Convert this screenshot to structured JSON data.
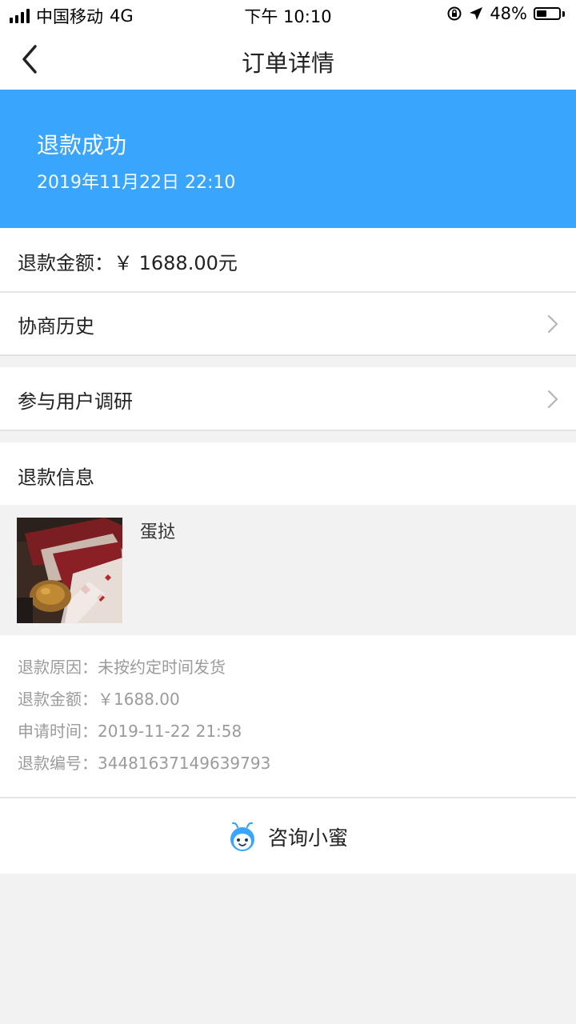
{
  "status_bar": {
    "carrier": "中国移动",
    "network": "4G",
    "time": "下午 10:10",
    "battery": "48%",
    "battery_level": 0.48
  },
  "nav": {
    "title": "订单详情"
  },
  "banner": {
    "status": "退款成功",
    "time": "2019年11月22日  22:10",
    "color": "#3aa5fc"
  },
  "refund_amount_row": {
    "label": "退款金额：",
    "value": "￥ 1688.00元"
  },
  "rows": {
    "history": "协商历史",
    "survey": "参与用户调研"
  },
  "refund_info": {
    "title": "退款信息",
    "product_name": "蛋挞",
    "details": [
      {
        "label": "退款原因：",
        "value": "未按约定时间发货"
      },
      {
        "label": "退款金额：",
        "value": "￥1688.00"
      },
      {
        "label": "申请时间：",
        "value": "2019-11-22 21:58"
      },
      {
        "label": "退款编号：",
        "value": "34481637149639793"
      }
    ]
  },
  "consult": {
    "label": "咨询小蜜",
    "icon": "bee-mascot-icon"
  }
}
